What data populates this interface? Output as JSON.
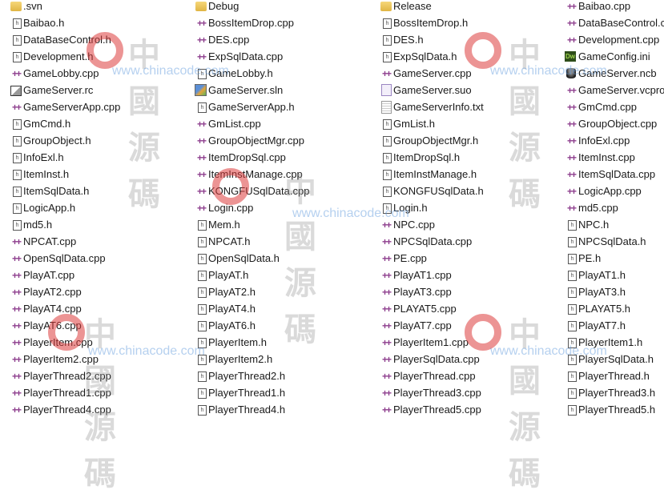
{
  "watermark": {
    "url": "www.chinacode.com",
    "chinese": "中國源碼"
  },
  "columns": [
    {
      "items": [
        {
          "name": ".svn",
          "icon": "folder"
        },
        {
          "name": "Baibao.h",
          "icon": "h"
        },
        {
          "name": "DataBaseControl.h",
          "icon": "h"
        },
        {
          "name": "Development.h",
          "icon": "h"
        },
        {
          "name": "GameLobby.cpp",
          "icon": "cpp"
        },
        {
          "name": "GameServer.rc",
          "icon": "rc"
        },
        {
          "name": "GameServerApp.cpp",
          "icon": "cpp"
        },
        {
          "name": "GmCmd.h",
          "icon": "h"
        },
        {
          "name": "GroupObject.h",
          "icon": "h"
        },
        {
          "name": "InfoExl.h",
          "icon": "h"
        },
        {
          "name": "ItemInst.h",
          "icon": "h"
        },
        {
          "name": "ItemSqlData.h",
          "icon": "h"
        },
        {
          "name": "LogicApp.h",
          "icon": "h"
        },
        {
          "name": "md5.h",
          "icon": "h"
        },
        {
          "name": "NPCAT.cpp",
          "icon": "cpp"
        },
        {
          "name": "OpenSqlData.cpp",
          "icon": "cpp"
        },
        {
          "name": "PlayAT.cpp",
          "icon": "cpp"
        },
        {
          "name": "PlayAT2.cpp",
          "icon": "cpp"
        },
        {
          "name": "PlayAT4.cpp",
          "icon": "cpp"
        },
        {
          "name": "PlayAT6.cpp",
          "icon": "cpp"
        },
        {
          "name": "PlayerItem.cpp",
          "icon": "cpp"
        },
        {
          "name": "PlayerItem2.cpp",
          "icon": "cpp"
        },
        {
          "name": "PlayerThread2.cpp",
          "icon": "cpp"
        },
        {
          "name": "PlayerThread1.cpp",
          "icon": "cpp"
        },
        {
          "name": "PlayerThread4.cpp",
          "icon": "cpp"
        }
      ]
    },
    {
      "items": [
        {
          "name": "Debug",
          "icon": "folder"
        },
        {
          "name": "BossItemDrop.cpp",
          "icon": "cpp"
        },
        {
          "name": "DES.cpp",
          "icon": "cpp"
        },
        {
          "name": "ExpSqlData.cpp",
          "icon": "cpp"
        },
        {
          "name": "GameLobby.h",
          "icon": "h"
        },
        {
          "name": "GameServer.sln",
          "icon": "sln"
        },
        {
          "name": "GameServerApp.h",
          "icon": "h"
        },
        {
          "name": "GmList.cpp",
          "icon": "cpp"
        },
        {
          "name": "GroupObjectMgr.cpp",
          "icon": "cpp"
        },
        {
          "name": "ItemDropSql.cpp",
          "icon": "cpp"
        },
        {
          "name": "ItemInstManage.cpp",
          "icon": "cpp"
        },
        {
          "name": "KONGFUSqlData.cpp",
          "icon": "cpp"
        },
        {
          "name": "Login.cpp",
          "icon": "cpp"
        },
        {
          "name": "Mem.h",
          "icon": "h"
        },
        {
          "name": "NPCAT.h",
          "icon": "h"
        },
        {
          "name": "OpenSqlData.h",
          "icon": "h"
        },
        {
          "name": "PlayAT.h",
          "icon": "h"
        },
        {
          "name": "PlayAT2.h",
          "icon": "h"
        },
        {
          "name": "PlayAT4.h",
          "icon": "h"
        },
        {
          "name": "PlayAT6.h",
          "icon": "h"
        },
        {
          "name": "PlayerItem.h",
          "icon": "h"
        },
        {
          "name": "PlayerItem2.h",
          "icon": "h"
        },
        {
          "name": "PlayerThread2.h",
          "icon": "h"
        },
        {
          "name": "PlayerThread1.h",
          "icon": "h"
        },
        {
          "name": "PlayerThread4.h",
          "icon": "h"
        }
      ]
    },
    {
      "items": [
        {
          "name": "Release",
          "icon": "folder"
        },
        {
          "name": "BossItemDrop.h",
          "icon": "h"
        },
        {
          "name": "DES.h",
          "icon": "h"
        },
        {
          "name": "ExpSqlData.h",
          "icon": "h"
        },
        {
          "name": "GameServer.cpp",
          "icon": "cpp"
        },
        {
          "name": "GameServer.suo",
          "icon": "suo"
        },
        {
          "name": "GameServerInfo.txt",
          "icon": "txt"
        },
        {
          "name": "GmList.h",
          "icon": "h"
        },
        {
          "name": "GroupObjectMgr.h",
          "icon": "h"
        },
        {
          "name": "ItemDropSql.h",
          "icon": "h"
        },
        {
          "name": "ItemInstManage.h",
          "icon": "h"
        },
        {
          "name": "KONGFUSqlData.h",
          "icon": "h"
        },
        {
          "name": "Login.h",
          "icon": "h"
        },
        {
          "name": "NPC.cpp",
          "icon": "cpp"
        },
        {
          "name": "NPCSqlData.cpp",
          "icon": "cpp"
        },
        {
          "name": "PE.cpp",
          "icon": "cpp"
        },
        {
          "name": "PlayAT1.cpp",
          "icon": "cpp"
        },
        {
          "name": "PlayAT3.cpp",
          "icon": "cpp"
        },
        {
          "name": "PLAYAT5.cpp",
          "icon": "cpp"
        },
        {
          "name": "PlayAT7.cpp",
          "icon": "cpp"
        },
        {
          "name": "PlayerItem1.cpp",
          "icon": "cpp"
        },
        {
          "name": "PlayerSqlData.cpp",
          "icon": "cpp"
        },
        {
          "name": "PlayerThread.cpp",
          "icon": "cpp"
        },
        {
          "name": "PlayerThread3.cpp",
          "icon": "cpp"
        },
        {
          "name": "PlayerThread5.cpp",
          "icon": "cpp"
        }
      ]
    },
    {
      "items": [
        {
          "name": "Baibao.cpp",
          "icon": "cpp"
        },
        {
          "name": "DataBaseControl.cpp",
          "icon": "cpp"
        },
        {
          "name": "Development.cpp",
          "icon": "cpp"
        },
        {
          "name": "GameConfig.ini",
          "icon": "ini"
        },
        {
          "name": "GameServer.ncb",
          "icon": "ncb"
        },
        {
          "name": "GameServer.vcproj",
          "icon": "cpp"
        },
        {
          "name": "GmCmd.cpp",
          "icon": "cpp"
        },
        {
          "name": "GroupObject.cpp",
          "icon": "cpp"
        },
        {
          "name": "InfoExl.cpp",
          "icon": "cpp"
        },
        {
          "name": "ItemInst.cpp",
          "icon": "cpp"
        },
        {
          "name": "ItemSqlData.cpp",
          "icon": "cpp"
        },
        {
          "name": "LogicApp.cpp",
          "icon": "cpp"
        },
        {
          "name": "md5.cpp",
          "icon": "cpp"
        },
        {
          "name": "NPC.h",
          "icon": "h"
        },
        {
          "name": "NPCSqlData.h",
          "icon": "h"
        },
        {
          "name": "PE.h",
          "icon": "h"
        },
        {
          "name": "PlayAT1.h",
          "icon": "h"
        },
        {
          "name": "PlayAT3.h",
          "icon": "h"
        },
        {
          "name": "PLAYAT5.h",
          "icon": "h"
        },
        {
          "name": "PlayAT7.h",
          "icon": "h"
        },
        {
          "name": "PlayerItem1.h",
          "icon": "h"
        },
        {
          "name": "PlayerSqlData.h",
          "icon": "h"
        },
        {
          "name": "PlayerThread.h",
          "icon": "h"
        },
        {
          "name": "PlayerThread3.h",
          "icon": "h"
        },
        {
          "name": "PlayerThread5.h",
          "icon": "h"
        }
      ]
    }
  ]
}
